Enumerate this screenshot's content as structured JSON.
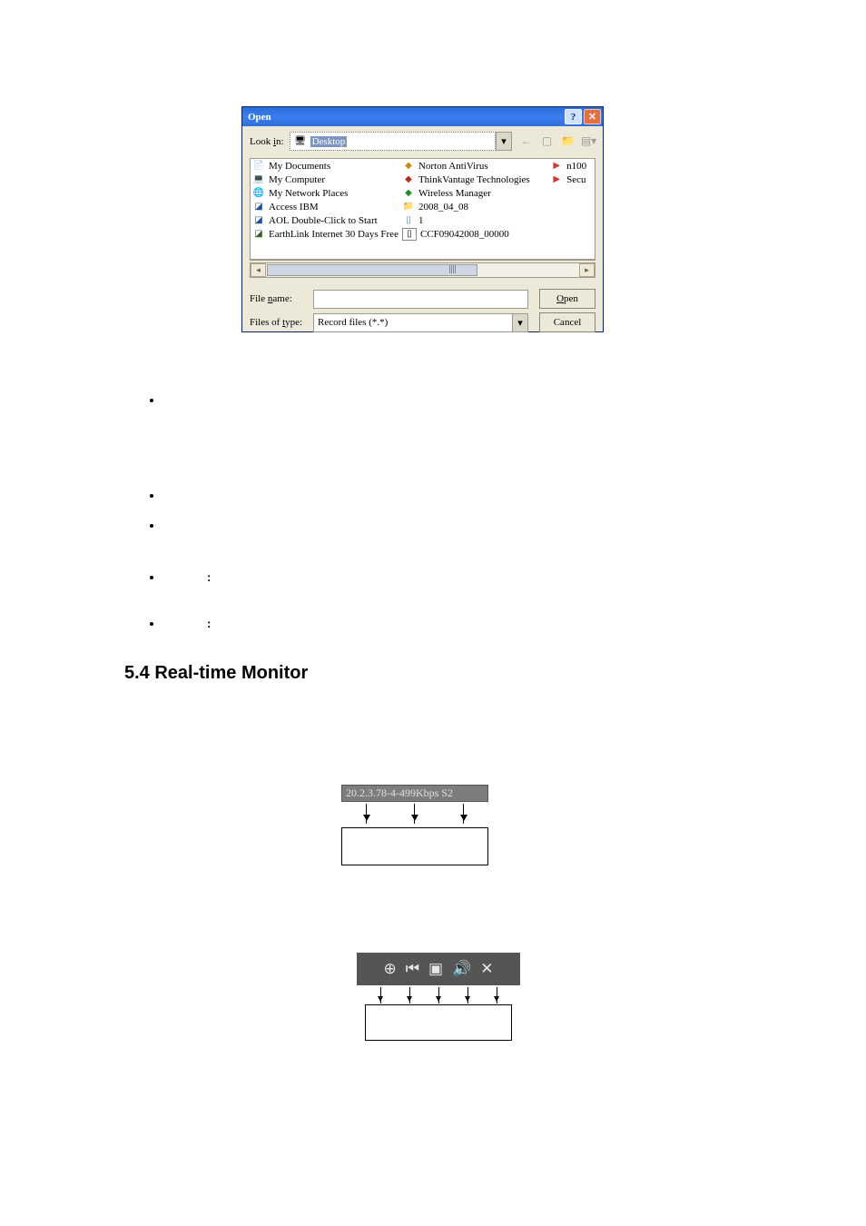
{
  "open_dialog": {
    "title": "Open",
    "look_in_label": "Look in:",
    "look_in_value": "Desktop",
    "toolbar_icons": [
      "back",
      "up",
      "new-folder",
      "views"
    ],
    "col1": [
      {
        "icon": "docs",
        "label": "My Documents"
      },
      {
        "icon": "comp",
        "label": "My Computer"
      },
      {
        "icon": "net",
        "label": "My Network Places"
      },
      {
        "icon": "ibm",
        "label": "Access IBM"
      },
      {
        "icon": "aol",
        "label": "AOL Double-Click to Start"
      },
      {
        "icon": "earth",
        "label": "EarthLink Internet 30 Days Free"
      }
    ],
    "col2": [
      {
        "icon": "norton",
        "label": "Norton AntiVirus"
      },
      {
        "icon": "tv",
        "label": "ThinkVantage Technologies"
      },
      {
        "icon": "wm",
        "label": "Wireless Manager"
      },
      {
        "icon": "fold",
        "label": "2008_04_08"
      },
      {
        "icon": "f1",
        "label": "1"
      },
      {
        "icon": "f2",
        "label": "CCF09042008_00000"
      }
    ],
    "col3": [
      {
        "icon": "red",
        "label": "n100"
      },
      {
        "icon": "red",
        "label": "Secu"
      }
    ],
    "file_name_label": "File name:",
    "files_of_type_label": "Files of type:",
    "files_of_type_value": "Record files (*.*)",
    "open_btn": "Open",
    "cancel_btn": "Cancel"
  },
  "heading": "5.4  Real-time Monitor",
  "monitor_label": "20.2.3.78-4-499Kbps S2"
}
